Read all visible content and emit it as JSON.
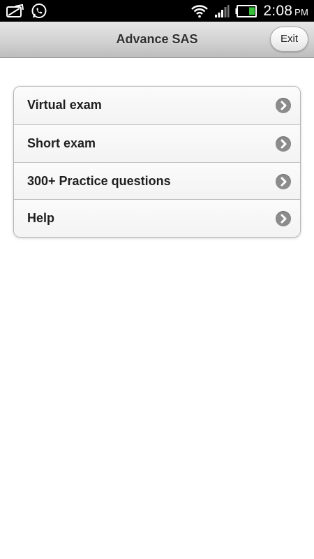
{
  "status_bar": {
    "time": "2:08",
    "ampm": "PM",
    "left_icons": [
      "notification-icon",
      "whatsapp-icon"
    ],
    "right_icons": [
      "wifi-icon",
      "signal-icon",
      "battery-icon"
    ]
  },
  "header": {
    "title": "Advance SAS",
    "exit_label": "Exit"
  },
  "menu": {
    "items": [
      {
        "label": "Virtual exam",
        "icon": "chevron-right-icon"
      },
      {
        "label": "Short exam",
        "icon": "chevron-right-icon"
      },
      {
        "label": "300+ Practice questions",
        "icon": "chevron-right-icon"
      },
      {
        "label": "Help",
        "icon": "chevron-right-icon"
      }
    ]
  }
}
